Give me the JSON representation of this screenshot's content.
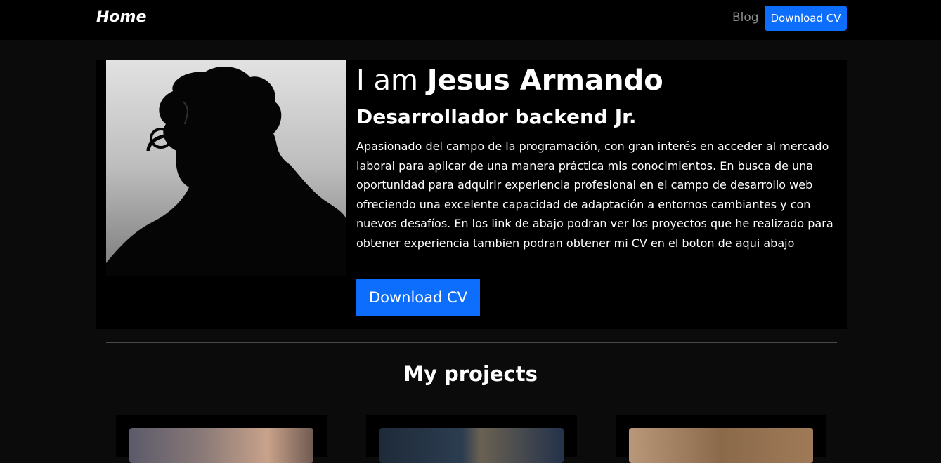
{
  "navbar": {
    "brand": "Home",
    "blog_label": "Blog",
    "cv_button": "Download CV"
  },
  "hero": {
    "title_prefix": "I am",
    "name": "Jesus Armando",
    "role": "Desarrollador backend Jr.",
    "bio": "Apasionado del campo de la programación, con gran interés en acceder al mercado laboral para aplicar de una manera práctica mis conocimientos. En busca de una oportunidad para adquirir experiencia profesional en el campo de desarrollo web ofreciendo una excelente capacidad de adaptación a entornos cambiantes y con nuevos desafíos. En los link de abajo podran ver los proyectos que he realizado para obtener experiencia tambien podran obtener mi CV en el boton de aqui abajo",
    "cv_button": "Download CV"
  },
  "projects": {
    "heading": "My projects"
  },
  "colors": {
    "accent": "#0d6efd",
    "background": "#0b0b0b",
    "panel": "#000000"
  }
}
